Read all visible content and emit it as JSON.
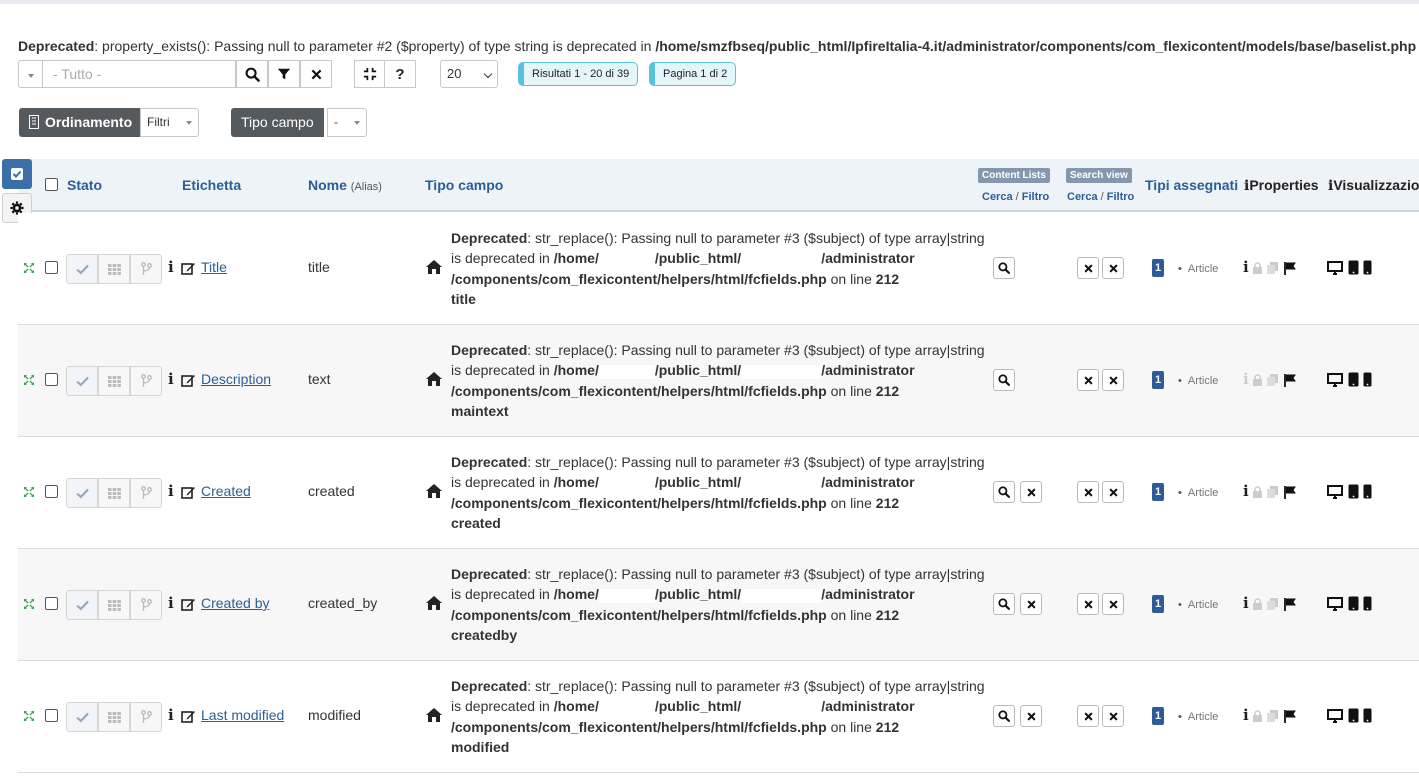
{
  "deprecated_top": {
    "label": "Deprecated",
    "message": ": property_exists(): Passing null to parameter #2 ($property) of type string is deprecated in ",
    "path": "/home/smzfbseq/public_html/IpfireItalia-4.it/administrator/components/com_flexicontent/models/base/baselist.php"
  },
  "toolbar": {
    "search_placeholder": "- Tutto -",
    "limit_value": "20",
    "results_badge": "Risultati 1 - 20 di 39",
    "page_badge": "Pagina 1 di 2"
  },
  "filters": {
    "ordering_label": "Ordinamento",
    "ordering_select": "Filtri",
    "field_type_label": "Tipo campo",
    "field_type_select": "-"
  },
  "table": {
    "headers": {
      "stato": "Stato",
      "etichetta": "Etichetta",
      "nome": "Nome",
      "alias": "(Alias)",
      "tipo_campo": "Tipo campo",
      "content_lists": "Content Lists",
      "search_view": "Search view",
      "cerca": "Cerca",
      "slash": " / ",
      "filtro": "Filtro",
      "tipi_assegnati": "Tipi assegnati",
      "properties": "Properties",
      "visualizzazioni": "Visualizzazio"
    },
    "deprecated_template": {
      "label": "Deprecated",
      "line1": ": str_replace(): Passing null to parameter #3 ($subject) of type array|string",
      "line2_prefix": "is deprecated in ",
      "home": "/home/",
      "public_html": "/public_html/",
      "administrator": "/administrator",
      "line3_path": "/components/com_flexicontent/helpers/html/fcfields.php",
      "line3_on": " on line ",
      "line3_num": "212"
    },
    "rows": [
      {
        "label": "Title",
        "name": "title",
        "field_type": "title",
        "assigned_count": "1",
        "assigned_type": "Article"
      },
      {
        "label": "Description",
        "name": "text",
        "field_type": "maintext",
        "assigned_count": "1",
        "assigned_type": "Article"
      },
      {
        "label": "Created",
        "name": "created",
        "field_type": "created",
        "assigned_count": "1",
        "assigned_type": "Article"
      },
      {
        "label": "Created by",
        "name": "created_by",
        "field_type": "createdby",
        "assigned_count": "1",
        "assigned_type": "Article"
      },
      {
        "label": "Last modified",
        "name": "modified",
        "field_type": "modified",
        "assigned_count": "1",
        "assigned_type": "Article"
      }
    ]
  },
  "colors": {
    "link": "#2b5e94",
    "header_bg": "#eef3f8",
    "info_badge": "#5bc0de",
    "dark_button": "#555a5f",
    "count_badge": "#2a5c97"
  }
}
